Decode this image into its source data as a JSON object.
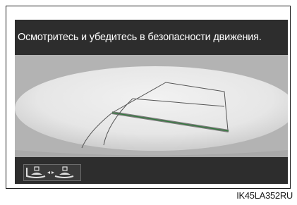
{
  "screen": {
    "message": "Осмотритесь и убедитесь в безопасности движения."
  },
  "bottom_bar": {
    "switch_icon": "front-rear-view-switch-icon"
  },
  "figure_code": "IK45LA352RU"
}
